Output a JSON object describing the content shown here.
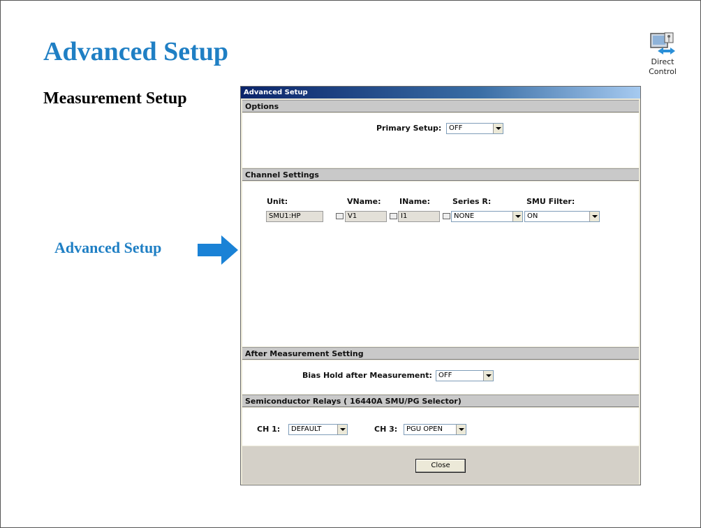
{
  "slide": {
    "title": "Advanced Setup",
    "subtitle": "Measurement Setup",
    "callout": "Advanced Setup",
    "direct_control": {
      "icon": "direct-control-icon",
      "label_line1": "Direct",
      "label_line2": "Control"
    }
  },
  "dialog": {
    "title": "Advanced Setup",
    "options": {
      "header": "Options",
      "primary_setup_label": "Primary Setup:",
      "primary_setup_value": "OFF"
    },
    "channel_settings": {
      "header": "Channel Settings",
      "columns": [
        "Unit:",
        "VName:",
        "IName:",
        "Series R:",
        "SMU Filter:"
      ],
      "row": {
        "unit": "SMU1:HP",
        "vname": "V1",
        "iname": "I1",
        "series_r": "NONE",
        "smu_filter": "ON"
      }
    },
    "after_measurement": {
      "header": "After Measurement Setting",
      "bias_hold_label": "Bias Hold after Measurement:",
      "bias_hold_value": "OFF"
    },
    "relays": {
      "header": "Semiconductor Relays ( 16440A SMU/PG Selector)",
      "ch1_label": "CH 1:",
      "ch1_value": "DEFAULT",
      "ch3_label": "CH 3:",
      "ch3_value": "PGU OPEN"
    },
    "close_label": "Close"
  },
  "colors": {
    "accent_blue": "#1f7fc4",
    "arrow_blue": "#1a82d6",
    "titlebar": "#0a246a"
  }
}
